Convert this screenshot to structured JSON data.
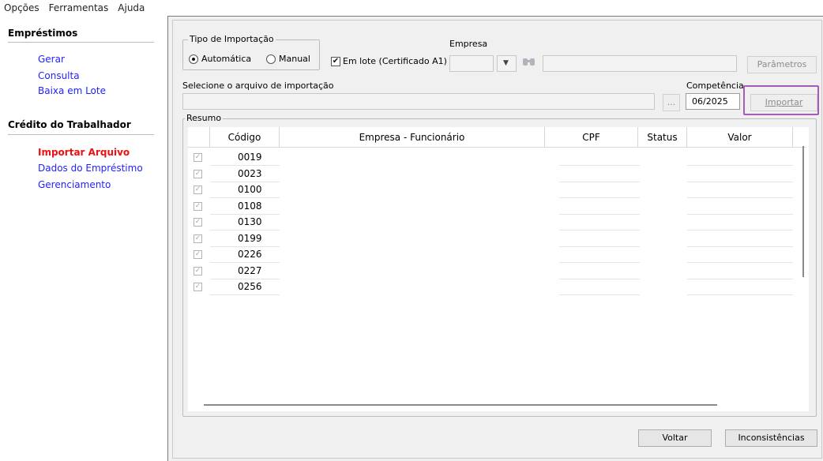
{
  "menu": [
    "Opções",
    "Ferramentas",
    "Ajuda"
  ],
  "sidebar": {
    "sections": [
      {
        "title": "Empréstimos",
        "items": [
          "Gerar",
          "Consulta",
          "Baixa em Lote"
        ]
      },
      {
        "title": "Crédito do Trabalhador",
        "items": [
          "Importar Arquivo",
          "Dados do Empréstimo",
          "Gerenciamento"
        ]
      }
    ],
    "active_item": "Importar Arquivo"
  },
  "form": {
    "tipo_importacao": {
      "title": "Tipo de Importação",
      "options": [
        "Automática",
        "Manual"
      ],
      "selected": "Automática"
    },
    "em_lote": {
      "label": "Em lote (Certificado A1)",
      "checked": true
    },
    "empresa": {
      "label": "Empresa",
      "value": ""
    },
    "parametros_button": "Parâmetros",
    "arquivo": {
      "label": "Selecione o arquivo de importação",
      "value": "",
      "browse": "..."
    },
    "competencia": {
      "label": "Competência",
      "value": "06/2025"
    },
    "importar_button": "Importar"
  },
  "resumo": {
    "title": "Resumo",
    "columns": [
      "Código",
      "Empresa - Funcionário",
      "CPF",
      "Status",
      "Valor"
    ],
    "rows": [
      {
        "checked": true,
        "codigo": "0019"
      },
      {
        "checked": true,
        "codigo": "0023"
      },
      {
        "checked": true,
        "codigo": "0100"
      },
      {
        "checked": true,
        "codigo": "0108"
      },
      {
        "checked": true,
        "codigo": "0130"
      },
      {
        "checked": true,
        "codigo": "0199"
      },
      {
        "checked": true,
        "codigo": "0226"
      },
      {
        "checked": true,
        "codigo": "0227"
      },
      {
        "checked": true,
        "codigo": "0256"
      }
    ]
  },
  "footer": {
    "voltar": "Voltar",
    "inconsistencias": "Inconsistências"
  },
  "colors": {
    "link": "#1f1fff",
    "active_link": "#ee1111",
    "highlight": "#a55bb8"
  }
}
